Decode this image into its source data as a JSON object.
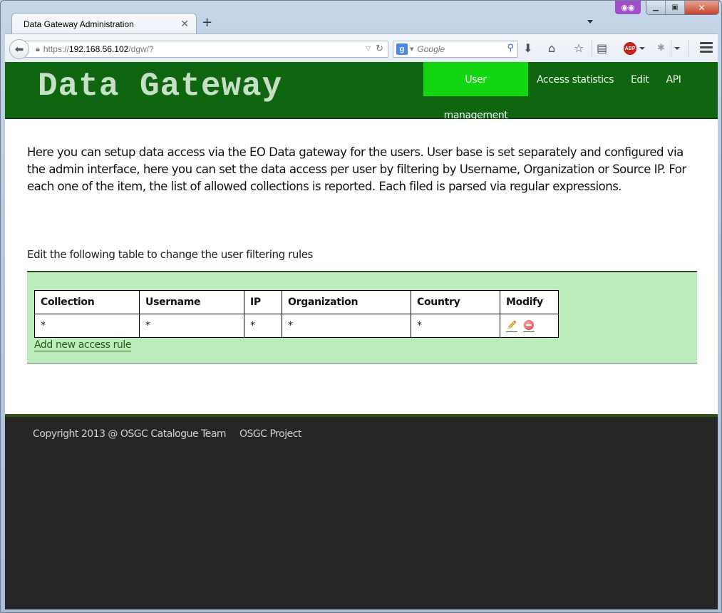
{
  "browser": {
    "tab_title": "Data Gateway Administration",
    "url_prefix": "https://",
    "url_host": "192.168.56.102",
    "url_path": "/dgw/?",
    "search_engine": "Google",
    "search_placeholder": "Google",
    "private_badge_icon": "mask-icon",
    "abp_label": "ABP"
  },
  "site": {
    "title": "Data Gateway",
    "nav": [
      {
        "label": "User management",
        "active": true
      },
      {
        "label": "Access statistics",
        "active": false
      },
      {
        "label": "Edit",
        "active": false
      },
      {
        "label": "API",
        "active": false
      }
    ],
    "brand_color": "#106510",
    "active_nav_color": "#12d612"
  },
  "main": {
    "intro": "Here you can setup data access via the EO Data gateway for the users. User base is set separately and configured via the admin interface, here you can set the data access per user by filtering by Username, Organization or Source IP. For each one of the item, the list of allowed collections is reported. Each filed is parsed via regular expressions.",
    "table_caption": "Edit the following table to change the user filtering rules",
    "table": {
      "columns": [
        "Collection",
        "Username",
        "IP",
        "Organization",
        "Country",
        "Modify"
      ],
      "rows": [
        {
          "collection": "*",
          "username": "*",
          "ip": "*",
          "organization": "*",
          "country": "*",
          "actions": [
            "edit-pencil-icon",
            "remove-icon"
          ]
        }
      ]
    },
    "add_rule_label": "Add new access rule"
  },
  "footer": {
    "copyright": "Copyright 2013 @ OSGC Catalogue Team",
    "project_link": "OSGC Project"
  }
}
